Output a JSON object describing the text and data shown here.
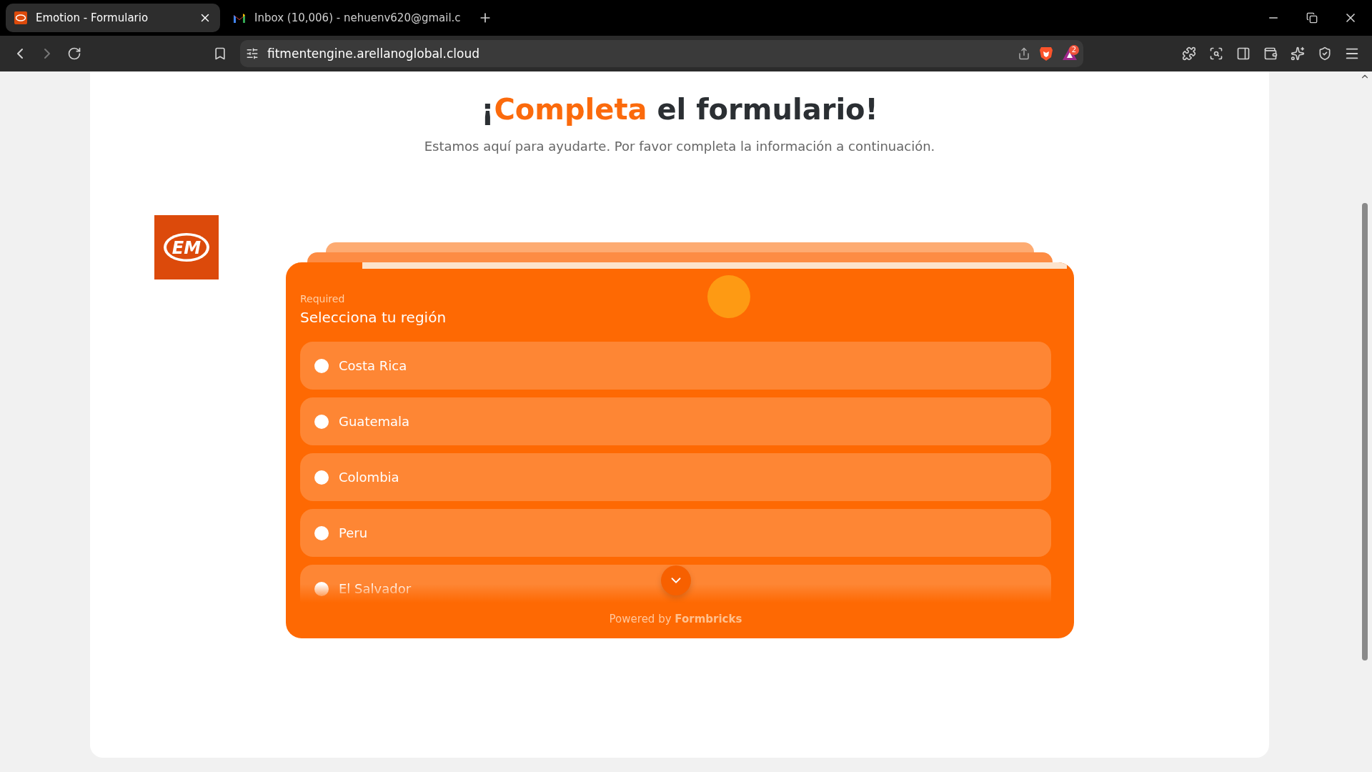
{
  "browser": {
    "tabs": [
      {
        "title": "Emotion - Formulario",
        "selected": true,
        "kind": "site"
      },
      {
        "title": "Inbox (10,006) - nehuenv620@gmail.c",
        "selected": false,
        "kind": "mail"
      }
    ],
    "url": "fitmentengine.arellanoglobal.cloud",
    "rewards_badge": "2"
  },
  "page": {
    "title": {
      "prefix": "¡",
      "highlight": "Completa",
      "rest": " el formulario!"
    },
    "subtitle": "Estamos aquí para ayudarte. Por favor completa la información a continuación.",
    "logo_text": "EM"
  },
  "form": {
    "progress": {
      "level": 0.09
    },
    "required_label": "Required",
    "question": "Selecciona tu región",
    "options": [
      {
        "label": "Costa Rica",
        "selected": false
      },
      {
        "label": "Guatemala",
        "selected": false
      },
      {
        "label": "Colombia",
        "selected": false
      },
      {
        "label": "Peru",
        "selected": false
      },
      {
        "label": "El Salvador",
        "selected": false
      }
    ],
    "footer": {
      "prefix": "Powered by",
      "brand": "Formbricks"
    }
  }
}
